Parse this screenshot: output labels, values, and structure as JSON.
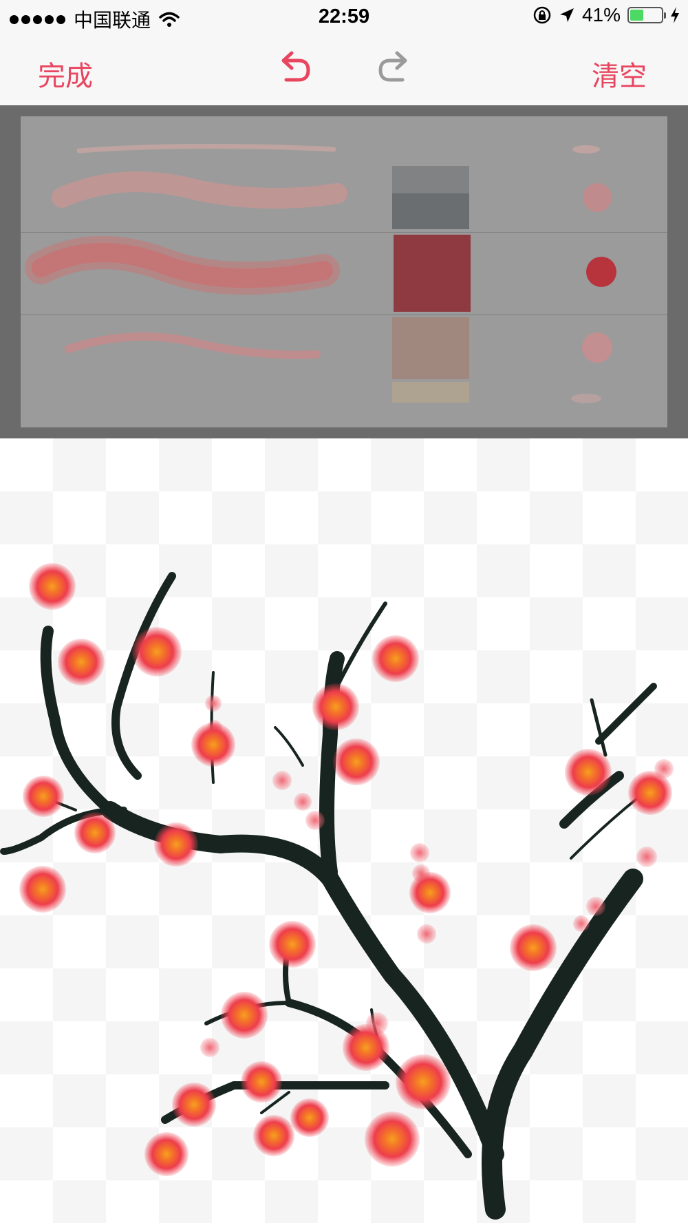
{
  "status_bar": {
    "carrier": "中国联通",
    "time": "22:59",
    "battery_percent": "41%",
    "battery_level": 0.41,
    "battery_color": "#4cd964"
  },
  "toolbar": {
    "done_label": "完成",
    "clear_label": "清空",
    "undo_icon": "undo-arrow-icon",
    "redo_icon": "redo-arrow-icon",
    "accent_color": "#e8455f",
    "redo_color": "#9a9a9a"
  },
  "brush_panel": {
    "rows": [
      {
        "swatch_color": "#6b6e70",
        "dot_color": "#c48a8c"
      },
      {
        "swatch_color": "#8f3a40",
        "dot_color": "#b7343d",
        "selected": true
      },
      {
        "swatch_color": "#a0887e",
        "dot_color": "#c88e90"
      }
    ]
  },
  "canvas": {
    "branch_color": "#172420",
    "blossom_color": "#ee3d4c",
    "blossom_center_color": "#f6a01f"
  }
}
